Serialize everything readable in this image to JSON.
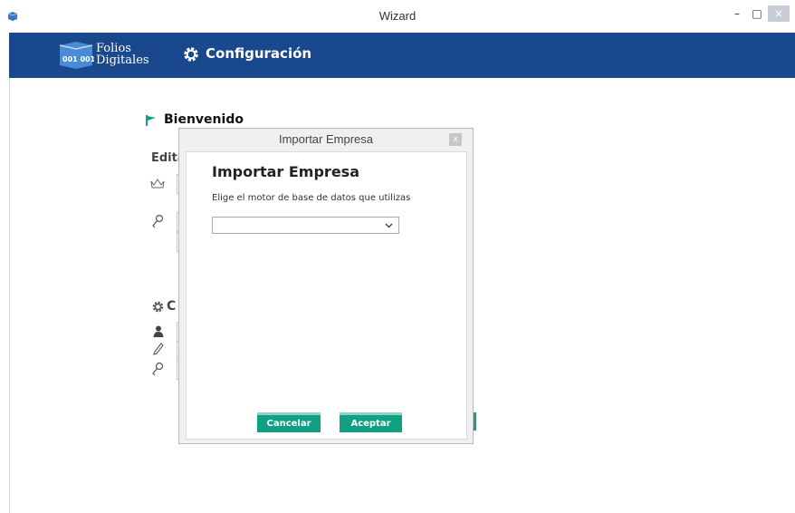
{
  "window": {
    "title": "Wizard",
    "minimize_glyph": "–",
    "maximize_glyph": "□",
    "close_glyph": "×"
  },
  "header": {
    "logo_line1": "Folios",
    "logo_line2": "Digitales",
    "logo_mark": "001 001",
    "config_label": "Configuración",
    "background_color": "#19488d"
  },
  "page": {
    "welcome_title": "Bienvenido",
    "section_label": "Edita",
    "section2_label": "C"
  },
  "dialog": {
    "title": "Importar Empresa",
    "close_label": "x",
    "heading": "Importar Empresa",
    "prompt": "Elige el motor de base de datos que utilizas",
    "select_value": "",
    "cancel_label": "Cancelar",
    "accept_label": "Aceptar",
    "accent_color": "#12a085"
  }
}
